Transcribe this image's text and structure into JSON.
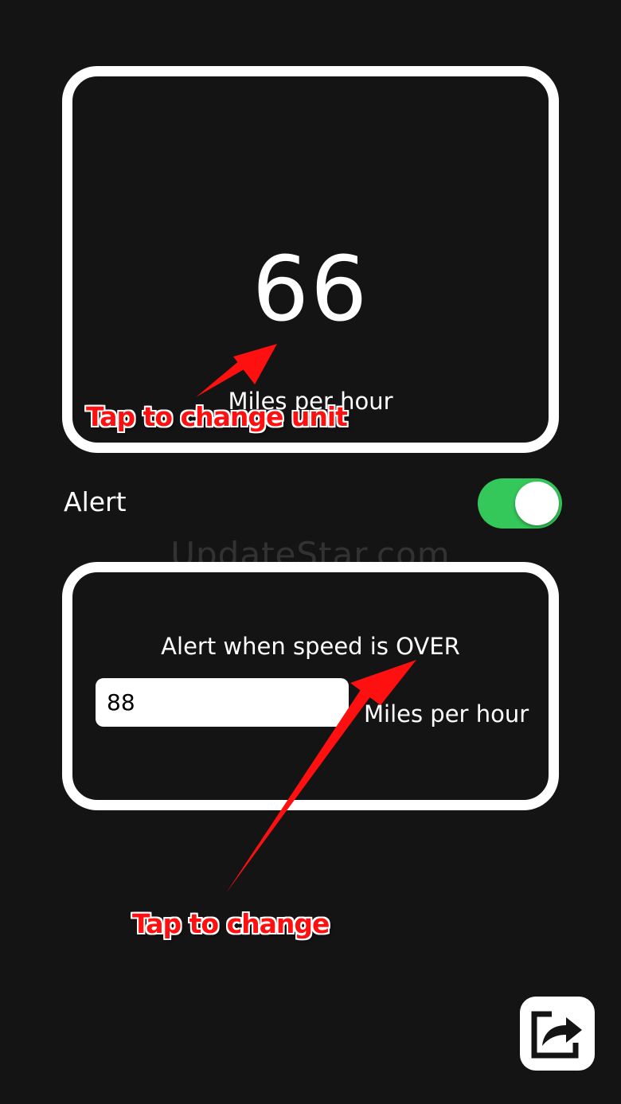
{
  "speed": {
    "value": "66",
    "unit": "Miles per hour"
  },
  "alert": {
    "label": "Alert",
    "enabled": true
  },
  "threshold": {
    "title": "Alert when speed is OVER",
    "value": "88",
    "unit": "Miles per hour"
  },
  "annotations": {
    "unit_hint": "Tap to change unit",
    "threshold_hint": "Tap to change"
  },
  "watermark": "UpdateStar.com",
  "icons": {
    "share": "share-icon"
  },
  "colors": {
    "background": "#141414",
    "toggle_on": "#34c759",
    "annotation": "#ff1010"
  }
}
